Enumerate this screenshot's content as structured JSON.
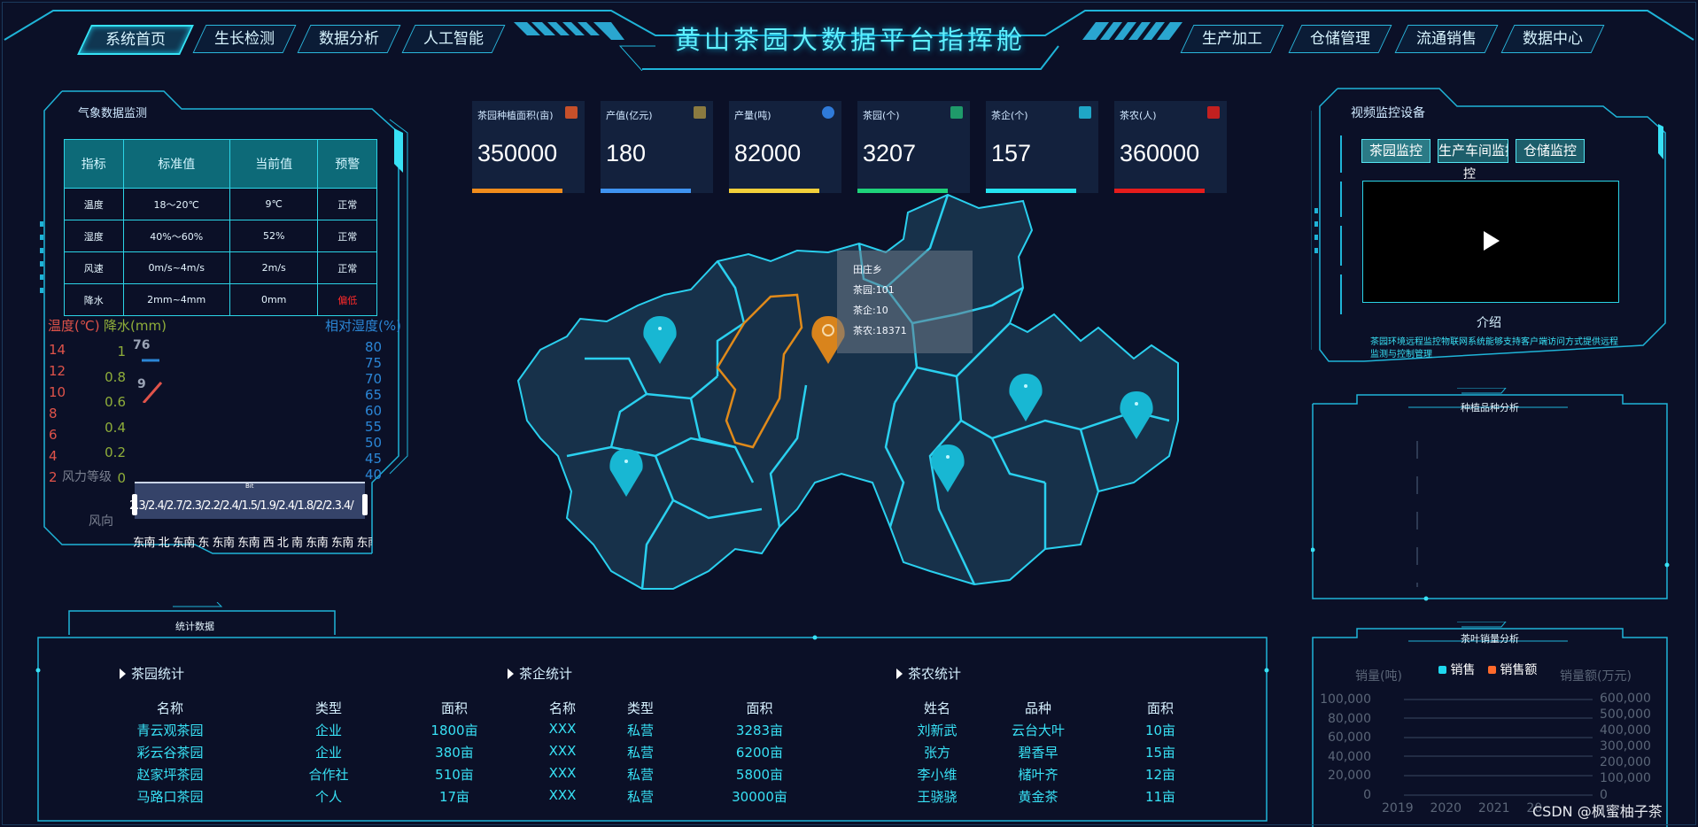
{
  "header": {
    "title": "黄山茶园大数据平台指挥舱",
    "left_tabs": [
      "系统首页",
      "生长检测",
      "数据分析",
      "人工智能"
    ],
    "right_tabs": [
      "生产加工",
      "仓储管理",
      "流通销售",
      "数据中心"
    ],
    "active_tab": "系统首页"
  },
  "weather": {
    "title": "气象数据监测",
    "columns": [
      "指标",
      "标准值",
      "当前值",
      "预警"
    ],
    "rows": [
      [
        "温度",
        "18～20℃",
        "9℃",
        "正常"
      ],
      [
        "湿度",
        "40%～60%",
        "52%",
        "正常"
      ],
      [
        "风速",
        "0m/s~4m/s",
        "2m/s",
        "正常"
      ],
      [
        "降水",
        "2mm~4mm",
        "0mm",
        "偏低"
      ]
    ],
    "warn_color": "#ff2a2a",
    "chart": {
      "temp_label": "温度(℃)",
      "rain_label": "降水(mm)",
      "humidity_label": "相对湿度(%)",
      "temp_ticks": [
        "14",
        "12",
        "10",
        "8",
        "6",
        "4",
        "2"
      ],
      "rain_ticks": [
        "1",
        "0.8",
        "0.6",
        "0.4",
        "0.2",
        "0"
      ],
      "humidity_ticks": [
        "80",
        "75",
        "70",
        "65",
        "60",
        "55",
        "50",
        "45",
        "40"
      ],
      "wind_label": "风力等级",
      "wind_dir_label": "风向",
      "overlap_labels": [
        "76",
        "9"
      ],
      "wind_values": "2.3/2.4/2.7/2.3/2.2/2.4/1.5/1.9/2.4/1.8/2/2.3.4/",
      "wind_dirs": "东南 北 东南 东 东南 东南 西  北  南 东南 东南 东南",
      "slider_label": "Bit"
    }
  },
  "kpis": [
    {
      "label": "茶园种植面积(亩)",
      "value": "350000",
      "color": "#f08c1c",
      "icon_color": "#c6502a"
    },
    {
      "label": "产值(亿元)",
      "value": "180",
      "color": "#3f93f0",
      "icon_color": "#8a7a40"
    },
    {
      "label": "产量(吨)",
      "value": "82000",
      "color": "#f2cf3a",
      "icon_color": "#2f7ad8"
    },
    {
      "label": "茶园(个)",
      "value": "3207",
      "color": "#1ed27a",
      "icon_color": "#1f9a6a"
    },
    {
      "label": "茶企(个)",
      "value": "157",
      "color": "#24e3f0",
      "icon_color": "#1fa6c6"
    },
    {
      "label": "茶农(人)",
      "value": "360000",
      "color": "#e61c1c",
      "icon_color": "#c22020"
    }
  ],
  "map": {
    "tooltip": {
      "name": "田庄乡",
      "garden": "茶园:101",
      "enterprise": "茶企:10",
      "farmers": "茶农:18371"
    }
  },
  "video": {
    "title": "视频监控设备",
    "tabs": [
      "茶园监控",
      "生产车间监控",
      "仓储监控"
    ],
    "play_icon": "play-icon",
    "intro_title": "介绍",
    "intro_text": "茶园环境远程监控物联网系统能够支持客户端访问方式提供远程监测与控制管理"
  },
  "variety": {
    "title": "种植品种分析"
  },
  "sales": {
    "title": "茶叶销量分析",
    "legend": [
      "销售",
      "销售额"
    ],
    "left_axis_label": "销量(吨)",
    "right_axis_label": "销量额(万元)",
    "left_ticks": [
      "100,000",
      "80,000",
      "60,000",
      "40,000",
      "20,000",
      "0"
    ],
    "right_ticks": [
      "600,000",
      "500,000",
      "400,000",
      "300,000",
      "200,000",
      "100,000",
      "0"
    ],
    "years": [
      "2019",
      "2020",
      "2021",
      "20"
    ],
    "legend_colors": [
      "#1fd8ee",
      "#ff6a2b"
    ]
  },
  "stats": {
    "title": "统计数据",
    "garden": {
      "title": "茶园统计",
      "columns": [
        "名称",
        "类型",
        "面积"
      ],
      "rows": [
        [
          "青云观茶园",
          "企业",
          "1800亩"
        ],
        [
          "彩云谷茶园",
          "企业",
          "380亩"
        ],
        [
          "赵家坪茶园",
          "合作社",
          "510亩"
        ],
        [
          "马路口茶园",
          "个人",
          "17亩"
        ]
      ]
    },
    "enterprise": {
      "title": "茶企统计",
      "columns": [
        "名称",
        "类型",
        "面积"
      ],
      "rows": [
        [
          "XXX",
          "私营",
          "3283亩"
        ],
        [
          "XXX",
          "私营",
          "6200亩"
        ],
        [
          "XXX",
          "私营",
          "5800亩"
        ],
        [
          "XXX",
          "私营",
          "30000亩"
        ]
      ]
    },
    "farmer": {
      "title": "茶农统计",
      "columns": [
        "姓名",
        "品种",
        "面积"
      ],
      "rows": [
        [
          "刘新武",
          "云台大叶",
          "10亩"
        ],
        [
          "张方",
          "碧香早",
          "15亩"
        ],
        [
          "李小维",
          "槠叶齐",
          "12亩"
        ],
        [
          "王骁骁",
          "黄金茶",
          "11亩"
        ]
      ]
    }
  },
  "watermark": "CSDN @枫蜜柚子茶"
}
